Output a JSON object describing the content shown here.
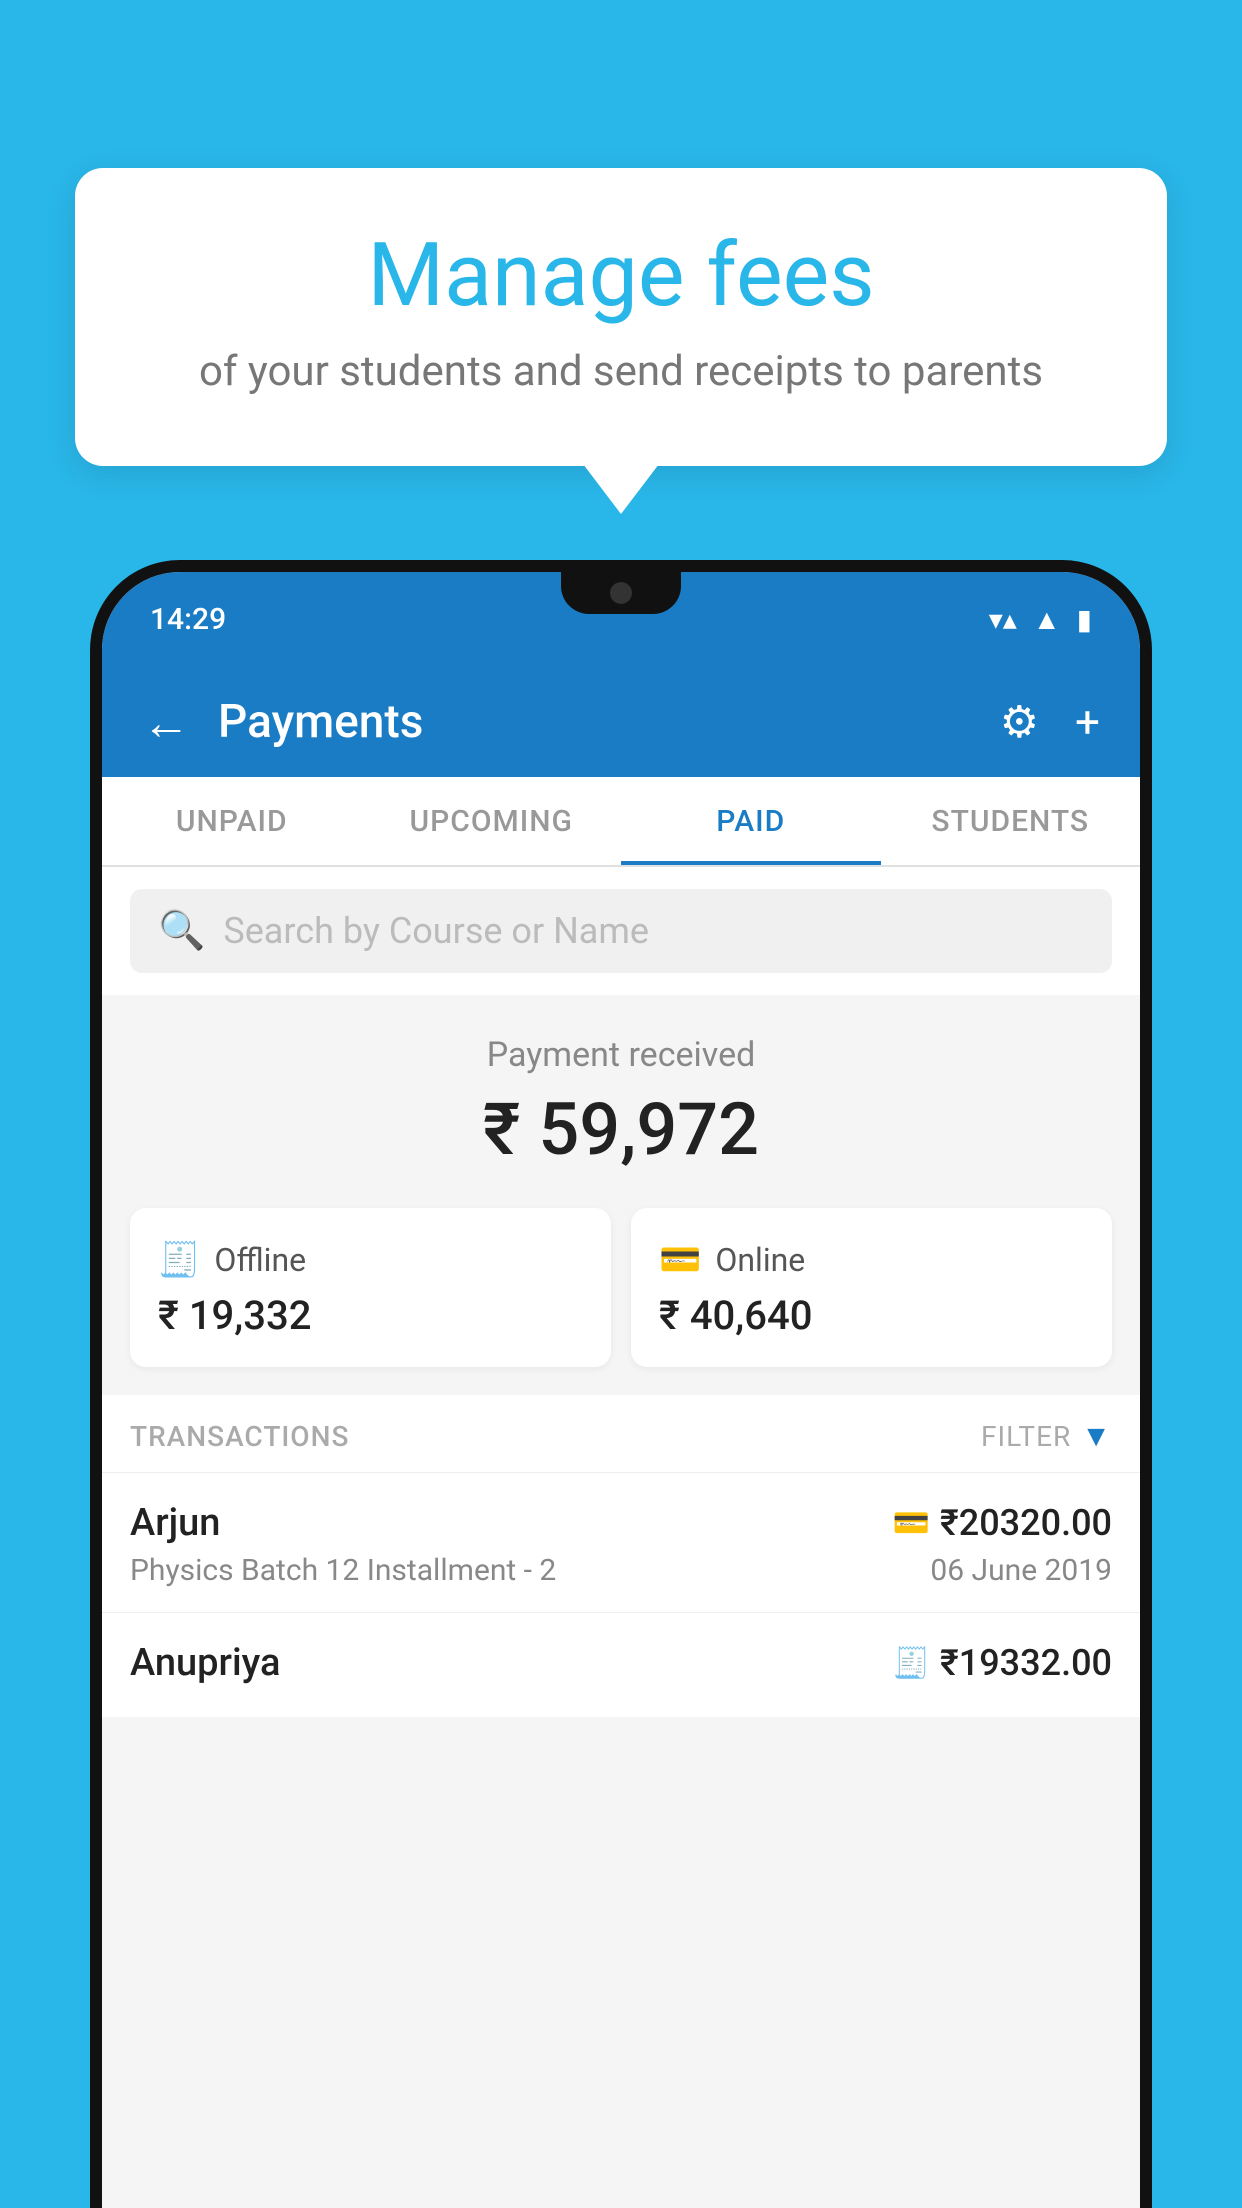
{
  "bubble": {
    "title": "Manage fees",
    "subtitle": "of your students and send receipts to parents"
  },
  "status_bar": {
    "time": "14:29"
  },
  "header": {
    "title": "Payments",
    "back_label": "←",
    "gear_label": "⚙",
    "plus_label": "+"
  },
  "tabs": [
    {
      "label": "UNPAID",
      "active": false
    },
    {
      "label": "UPCOMING",
      "active": false
    },
    {
      "label": "PAID",
      "active": true
    },
    {
      "label": "STUDENTS",
      "active": false
    }
  ],
  "search": {
    "placeholder": "Search by Course or Name"
  },
  "payment_received": {
    "label": "Payment received",
    "amount": "₹ 59,972"
  },
  "cards": {
    "offline": {
      "icon": "🧾",
      "label": "Offline",
      "amount": "₹ 19,332"
    },
    "online": {
      "icon": "💳",
      "label": "Online",
      "amount": "₹ 40,640"
    }
  },
  "transactions_header": {
    "label": "TRANSACTIONS",
    "filter_label": "FILTER"
  },
  "transactions": [
    {
      "name": "Arjun",
      "description": "Physics Batch 12 Installment - 2",
      "amount": "₹20320.00",
      "date": "06 June 2019",
      "payment_type": "card"
    },
    {
      "name": "Anupriya",
      "description": "",
      "amount": "₹19332.00",
      "date": "",
      "payment_type": "cash"
    }
  ]
}
